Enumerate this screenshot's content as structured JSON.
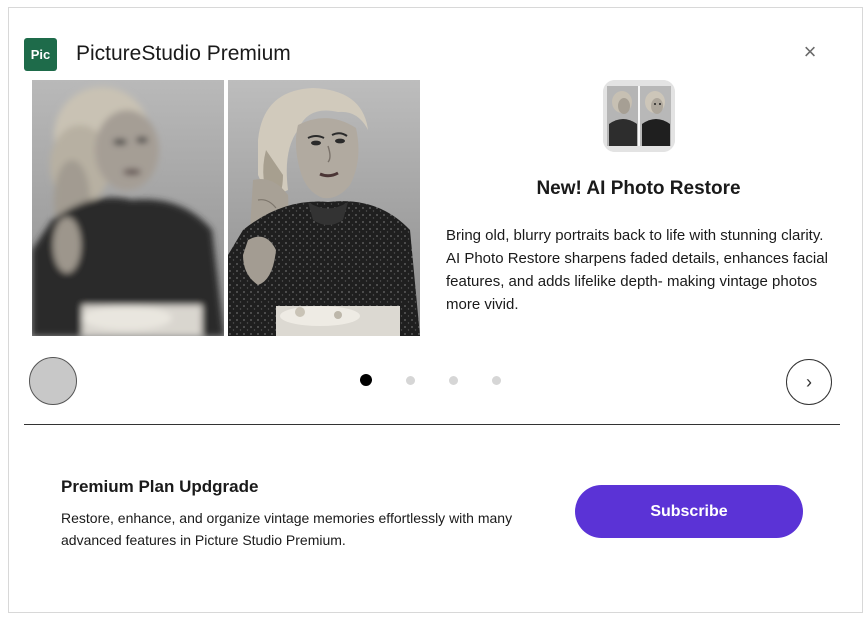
{
  "header": {
    "logo_text": "Pic",
    "title": "PictureStudio Premium",
    "close_glyph": "×"
  },
  "feature": {
    "title": "New! AI Photo Restore",
    "description": "Bring old, blurry portraits back to life with stunning clarity. AI Photo Restore sharpens faded details, enhances facial features, and adds lifelike depth- making vintage photos more vivid."
  },
  "carousel": {
    "slide_count": 4,
    "active_index": 0,
    "next_glyph": "›"
  },
  "upgrade": {
    "title": "Premium Plan Updgrade",
    "description": "Restore, enhance, and organize vintage memories effortlessly with many advanced features in Picture Studio Premium.",
    "subscribe_label": "Subscribe"
  },
  "colors": {
    "logo_bg": "#1e6b4a",
    "subscribe_bg": "#5b33d6",
    "dot_active": "#000000",
    "dot_inactive": "#d6d6d6"
  },
  "icons": [
    "pic-logo-icon",
    "close-icon",
    "feature-photo-icon",
    "chevron-right-icon"
  ]
}
